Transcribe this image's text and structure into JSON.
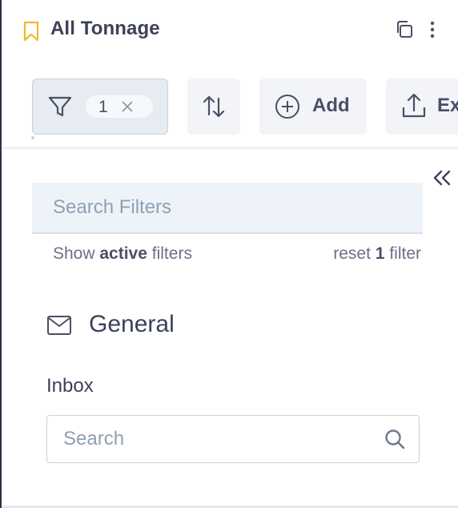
{
  "header": {
    "title": "All Tonnage",
    "icons": {
      "bookmark": "bookmark-icon",
      "copy": "copy-icon",
      "more": "more-vertical-icon"
    }
  },
  "toolbar": {
    "filter_count": "1",
    "add_label": "Add",
    "export_label": "Ex",
    "icons": {
      "filter": "funnel-icon",
      "clear": "close-icon",
      "sort": "sort-arrows-icon",
      "add": "plus-circle-icon",
      "export": "upload-icon"
    }
  },
  "filters": {
    "search_placeholder": "Search Filters",
    "show_prefix": "Show",
    "show_bold": "active",
    "show_suffix": "filters",
    "reset_prefix": "reset",
    "reset_count": "1",
    "reset_suffix": "filter",
    "collapse_icon": "chevrons-left-icon"
  },
  "general": {
    "title": "General",
    "icon": "mail-icon",
    "inbox_label": "Inbox",
    "inbox_search_placeholder": "Search",
    "search_icon": "search-icon"
  },
  "colors": {
    "accent": "#f2b92c",
    "text": "#3d4159",
    "muted": "#6a708a",
    "icon": "#4a4f66",
    "placeholder": "#8fa0b4"
  }
}
